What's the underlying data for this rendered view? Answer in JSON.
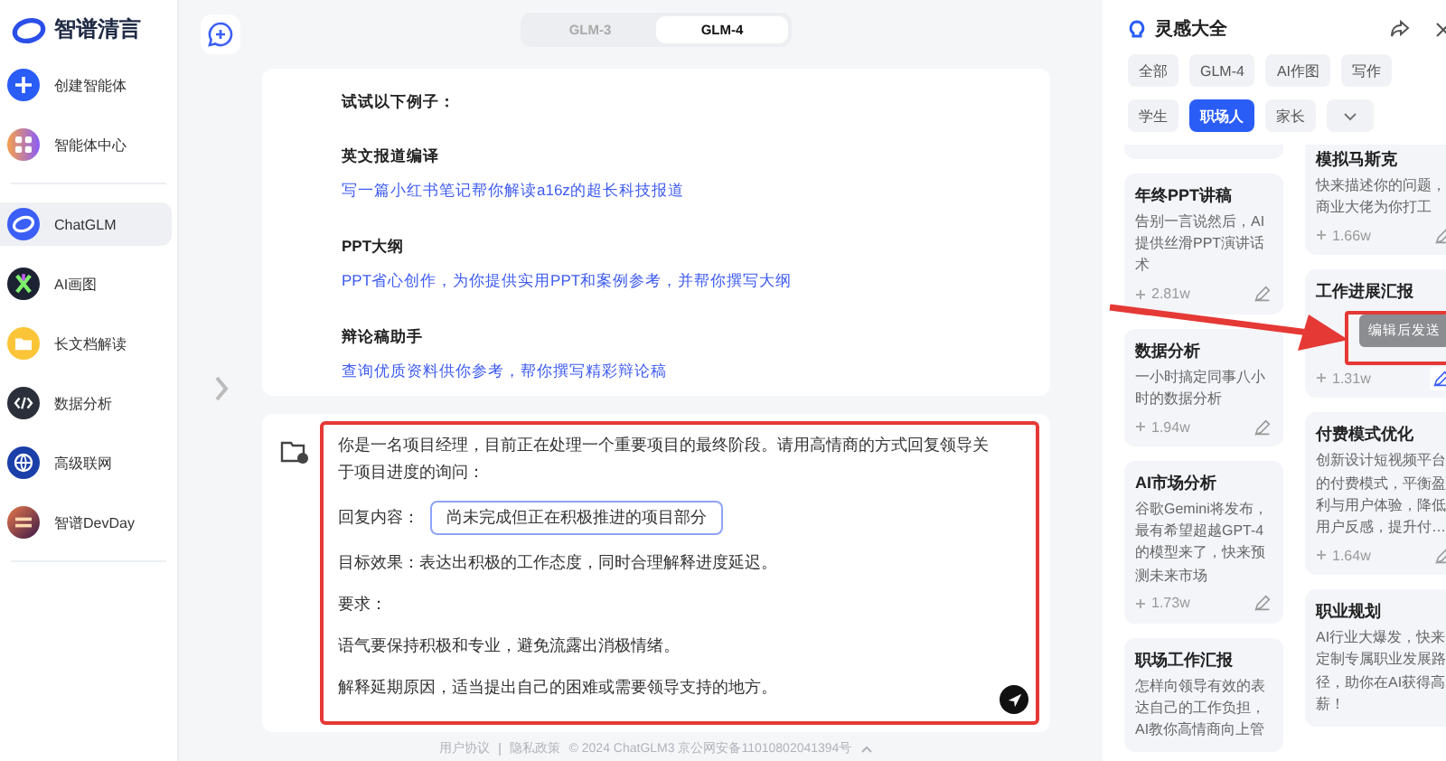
{
  "sidebar": {
    "logo": "智谱清言",
    "items": [
      {
        "label": "创建智能体",
        "selected": false
      },
      {
        "label": "智能体中心",
        "selected": false
      },
      {
        "label": "ChatGLM",
        "selected": true
      },
      {
        "label": "AI画图",
        "selected": false
      },
      {
        "label": "长文档解读",
        "selected": false
      },
      {
        "label": "数据分析",
        "selected": false
      },
      {
        "label": "高级联网",
        "selected": false
      },
      {
        "label": "智谱DevDay",
        "selected": false
      }
    ]
  },
  "model_switch": [
    {
      "label": "GLM-3",
      "selected": false
    },
    {
      "label": "GLM-4",
      "selected": true
    }
  ],
  "examples": {
    "heading": "试试以下例子：",
    "items": [
      {
        "title": "英文报道编译",
        "prompt": "写一篇小红书笔记帮你解读a16z的超长科技报道"
      },
      {
        "title": "PPT大纲",
        "prompt": "PPT省心创作，为你提供实用PPT和案例参考，并帮你撰写大纲"
      },
      {
        "title": "辩论稿助手",
        "prompt": "查询优质资料供你参考，帮你撰写精彩辩论稿"
      }
    ]
  },
  "composer": {
    "lines": [
      {
        "kind": "text",
        "text": "你是一名项目经理，目前正在处理一个重要项目的最终阶段。请用高情商的方式回复领导关于项目进度的询问："
      },
      {
        "kind": "field",
        "label": "回复内容：",
        "value": "尚未完成但正在积极推进的项目部分"
      },
      {
        "kind": "text",
        "text": "目标效果：表达出积极的工作态度，同时合理解释进度延迟。"
      },
      {
        "kind": "text",
        "text": "要求："
      },
      {
        "kind": "text",
        "text": "语气要保持积极和专业，避免流露出消极情绪。"
      },
      {
        "kind": "text",
        "text": "解释延期原因，适当提出自己的困难或需要领导支持的地方。"
      }
    ]
  },
  "footer": {
    "links": [
      "用户协议",
      "隐私政策"
    ],
    "copyright": "© 2024 ChatGLM3 京公网安备11010802041394号"
  },
  "inspiration": {
    "title": "灵感大全",
    "tags": [
      {
        "label": "全部",
        "selected": false
      },
      {
        "label": "GLM-4",
        "selected": false
      },
      {
        "label": "AI作图",
        "selected": false
      },
      {
        "label": "写作",
        "selected": false
      },
      {
        "label": "学生",
        "selected": false
      },
      {
        "label": "职场人",
        "selected": true
      },
      {
        "label": "家长",
        "selected": false
      }
    ],
    "columns": [
      [
        {
          "kind": "stub"
        },
        {
          "kind": "card",
          "title": "年终PPT讲稿",
          "description": "告别一言说然后，AI提供丝滑PPT演讲话术",
          "count": "2.81w"
        },
        {
          "kind": "card",
          "title": "数据分析",
          "description": "一小时搞定同事八小时的数据分析",
          "count": "1.94w"
        },
        {
          "kind": "card",
          "title": "AI市场分析",
          "description": "谷歌Gemini将发布，最有希望超越GPT-4的模型来了，快来预测未来市场",
          "count": "1.73w"
        },
        {
          "kind": "card",
          "title": "职场工作汇报",
          "description": "怎样向领导有效的表达自己的工作负担，AI教你高情商向上管"
        }
      ],
      [
        {
          "kind": "card",
          "title": "模拟马斯克",
          "description": "快来描述你的问题，商业大佬为你打工",
          "count": "1.66w"
        },
        {
          "kind": "card",
          "title": "工作进展汇报",
          "count": "1.31w",
          "tooltip": "编辑后发送"
        },
        {
          "kind": "card",
          "title": "付费模式优化",
          "description": "创新设计短视频平台的付费模式，平衡盈利与用户体验，降低用户反感，提升付…",
          "count": "1.64w"
        },
        {
          "kind": "card",
          "title": "职业规划",
          "description": "AI行业大爆发，快来定制专属职业发展路径，助你在AI获得高薪！"
        }
      ]
    ]
  }
}
